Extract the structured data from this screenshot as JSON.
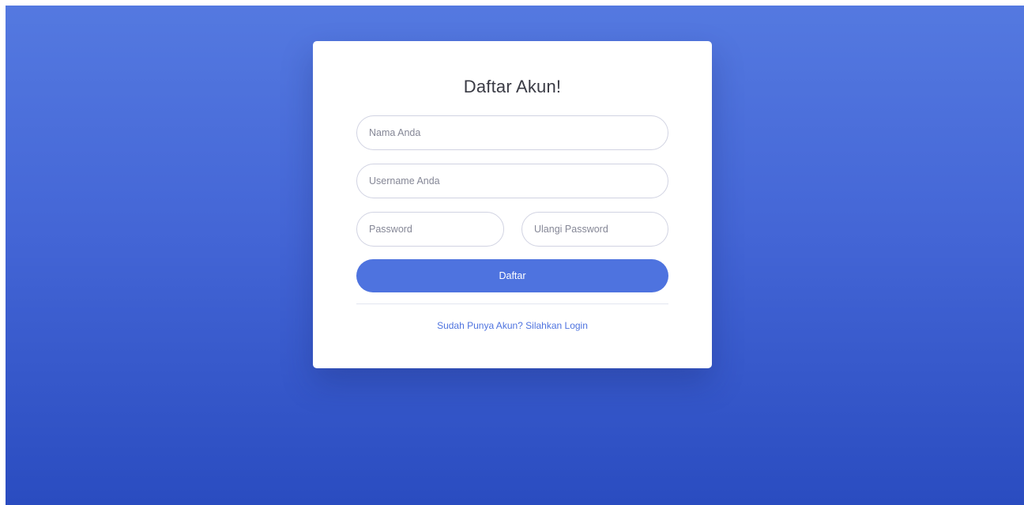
{
  "register": {
    "title": "Daftar Akun!",
    "name_placeholder": "Nama Anda",
    "username_placeholder": "Username Anda",
    "password_placeholder": "Password",
    "repeat_password_placeholder": "Ulangi Password",
    "submit_label": "Daftar",
    "login_link": "Sudah Punya Akun? Silahkan Login"
  },
  "colors": {
    "primary": "#4e73df",
    "background_top": "#5479e0",
    "background_bottom": "#2a4cc0",
    "card": "#ffffff"
  }
}
